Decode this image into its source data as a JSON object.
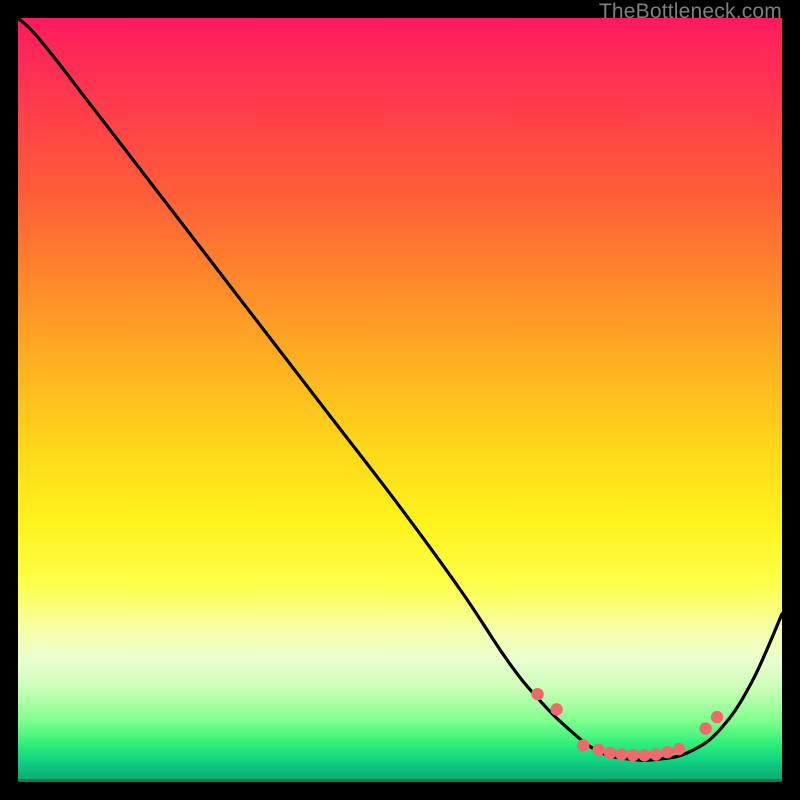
{
  "watermark": "TheBottleneck.com",
  "chart_data": {
    "type": "line",
    "title": "",
    "xlabel": "",
    "ylabel": "",
    "xlim": [
      0,
      100
    ],
    "ylim": [
      0,
      100
    ],
    "grid": false,
    "series": [
      {
        "name": "curve",
        "x": [
          0,
          3,
          10,
          20,
          30,
          40,
          50,
          58,
          64,
          68,
          72,
          76,
          80,
          84,
          88,
          92,
          96,
          100
        ],
        "y": [
          100,
          97,
          88,
          75,
          62,
          49,
          36,
          25,
          16,
          11,
          7,
          4,
          3,
          3,
          4,
          7,
          13,
          22
        ]
      }
    ],
    "markers": {
      "name": "dots",
      "color": "#ef6a6a",
      "x": [
        68,
        70.5,
        74,
        76,
        77.5,
        79,
        80.5,
        82,
        83.5,
        85,
        86.5,
        90,
        91.5
      ],
      "y": [
        11.5,
        9.5,
        4.8,
        4.2,
        3.8,
        3.6,
        3.5,
        3.5,
        3.6,
        3.9,
        4.3,
        7.0,
        8.5
      ]
    }
  }
}
